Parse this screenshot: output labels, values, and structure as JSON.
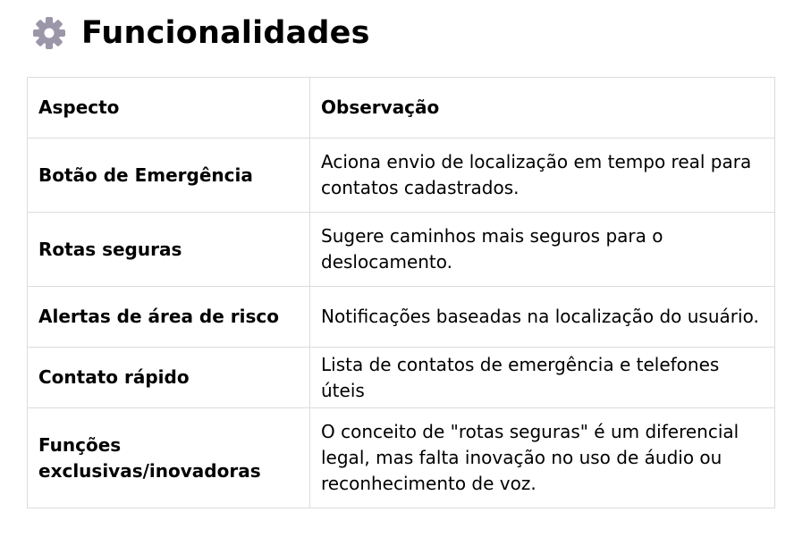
{
  "heading": {
    "icon": "gear-icon",
    "title": "Funcionalidades"
  },
  "table": {
    "headers": [
      "Aspecto",
      "Observação"
    ],
    "rows": [
      {
        "aspect": "Botão de Emergência",
        "observation": "Aciona envio de localização em tempo real para contatos cadastrados."
      },
      {
        "aspect": "Rotas seguras",
        "observation": "Sugere caminhos mais seguros para o deslocamento."
      },
      {
        "aspect": "Alertas de área de risco",
        "observation": "Notificações baseadas na localização do usuário."
      },
      {
        "aspect": "Contato rápido",
        "observation": "Lista de contatos de emergência e telefones úteis"
      },
      {
        "aspect": "Funções exclusivas/inovadoras",
        "observation": "O conceito de \"rotas seguras\" é um diferencial legal, mas falta inovação no uso de áudio ou reconhecimento de voz."
      }
    ]
  },
  "colors": {
    "gear": "#9b96a8",
    "border": "#dcdcdc",
    "text": "#000000"
  }
}
